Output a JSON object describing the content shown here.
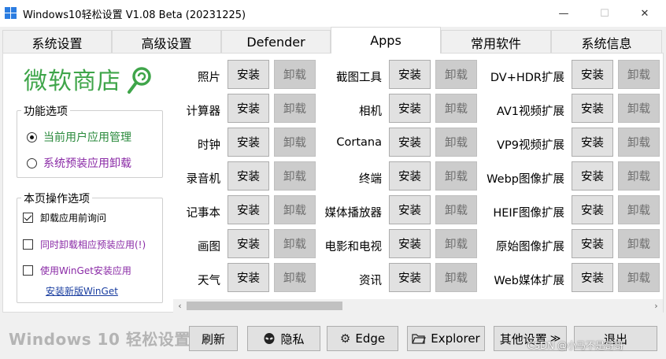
{
  "window": {
    "title": "Windows10轻松设置 V1.08 Beta (20231225)",
    "min": "—",
    "max": "☐",
    "close": "✕"
  },
  "tabs": [
    "系统设置",
    "高级设置",
    "Defender",
    "Apps",
    "常用软件",
    "系统信息"
  ],
  "active_tab": "Apps",
  "left": {
    "store_title": "微软商店",
    "features_legend": "功能选项",
    "radios": [
      {
        "label": "当前用户应用管理",
        "checked": true,
        "color": "#2a8a3c"
      },
      {
        "label": "系统预装应用卸载",
        "checked": false,
        "color": "#8a2aa6"
      }
    ],
    "options_legend": "本页操作选项",
    "checkboxes": [
      {
        "label": "卸载应用前询问",
        "checked": true,
        "color": "#000000"
      },
      {
        "label": "同时卸载相应预装应用(!)",
        "checked": false,
        "color": "#8a2aa6"
      },
      {
        "label": "使用WinGet安装应用",
        "checked": false,
        "color": "#8a2aa6"
      }
    ],
    "winget_link": "安装新版WinGet"
  },
  "apps": {
    "install_label": "安装",
    "uninstall_label": "卸载",
    "columns": [
      [
        "照片",
        "计算器",
        "时钟",
        "录音机",
        "记事本",
        "画图",
        "天气"
      ],
      [
        "截图工具",
        "相机",
        "Cortana",
        "终端",
        "媒体播放器",
        "电影和电视",
        "资讯"
      ],
      [
        "DV+HDR扩展",
        "AV1视频扩展",
        "VP9视频扩展",
        "Webp图像扩展",
        "HEIF图像扩展",
        "原始图像扩展",
        "Web媒体扩展"
      ]
    ]
  },
  "scrollbar": {
    "left": "‹",
    "right": "›"
  },
  "footer": {
    "title": "Windows 10 轻松设置",
    "refresh": "刷新",
    "privacy": "隐私",
    "edge": "Edge",
    "explorer": "Explorer",
    "other_settings": "其他设置",
    "other_settings_arrow": "≫",
    "exit": "退出",
    "watermark": "CSDN @小马不是哥哥"
  },
  "colors": {
    "store_green": "#3fa54a",
    "link_blue": "#1a3ea0"
  },
  "icons": {
    "privacy": "alien-icon",
    "edge": "gear-icon",
    "explorer": "folder-icon"
  }
}
